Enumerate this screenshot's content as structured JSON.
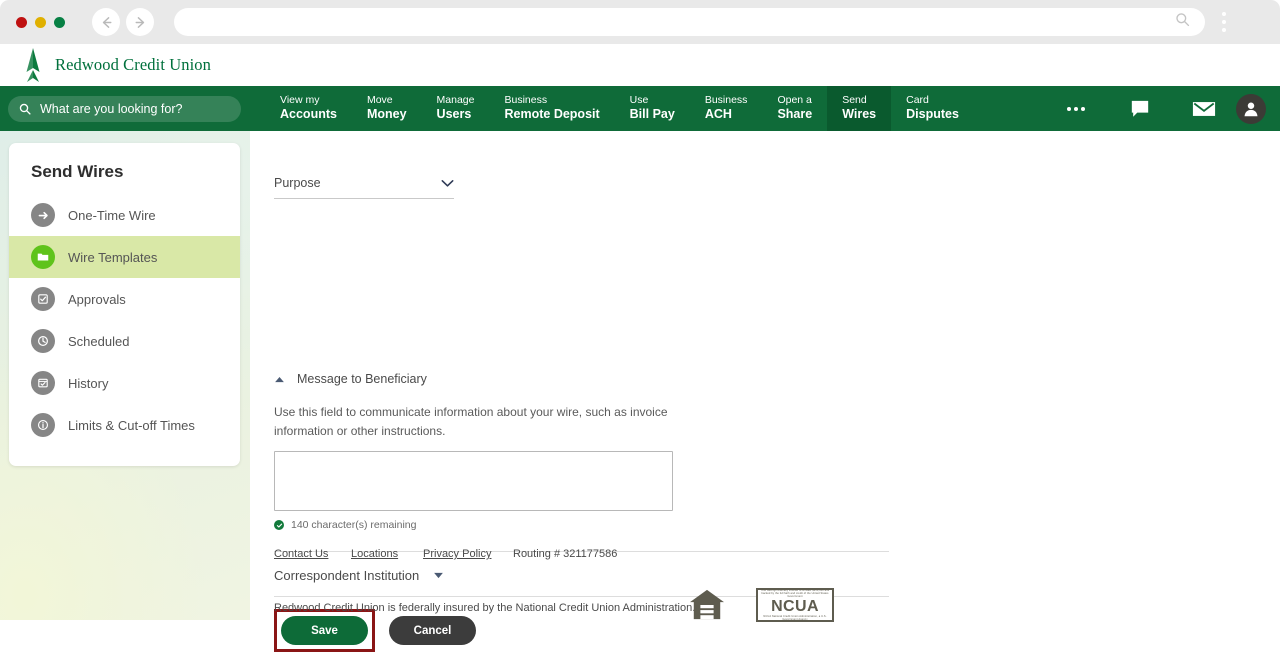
{
  "browser": {
    "url_value": "",
    "url_placeholder": "",
    "back_icon": "back-arrow-icon",
    "forward_icon": "forward-arrow-icon",
    "search_icon": "search-icon",
    "menu_icon": "kebab-menu-icon"
  },
  "brand": {
    "name": "Redwood Credit Union",
    "logo_icon": "redwood-tree-logo",
    "primary_green": "#0f6b39",
    "active_green": "#0a5a2e",
    "accent_lime": "#5fc31b",
    "highlight_red": "#8a1515"
  },
  "navbar": {
    "search_placeholder": "What are you looking for?",
    "search_icon": "search-icon",
    "items": [
      {
        "top": "View my",
        "bottom": "Accounts",
        "active": false
      },
      {
        "top": "Move",
        "bottom": "Money",
        "active": false
      },
      {
        "top": "Manage",
        "bottom": "Users",
        "active": false
      },
      {
        "top": "Business",
        "bottom": "Remote Deposit",
        "active": false
      },
      {
        "top": "Use",
        "bottom": "Bill Pay",
        "active": false
      },
      {
        "top": "Business",
        "bottom": "ACH",
        "active": false
      },
      {
        "top": "Open a",
        "bottom": "Share",
        "active": false
      },
      {
        "top": "Send",
        "bottom": "Wires",
        "active": true
      },
      {
        "top": "Card",
        "bottom": "Disputes",
        "active": false
      }
    ],
    "more_icon": "ellipsis-icon",
    "chat_icon": "chat-bubble-icon",
    "mail_icon": "envelope-icon",
    "profile_icon": "user-avatar-icon"
  },
  "sidebar": {
    "title": "Send Wires",
    "items": [
      {
        "label": "One-Time Wire",
        "icon": "arrow-right-circle-icon",
        "active": false
      },
      {
        "label": "Wire Templates",
        "icon": "folder-icon",
        "active": true
      },
      {
        "label": "Approvals",
        "icon": "check-circle-icon",
        "active": false
      },
      {
        "label": "Scheduled",
        "icon": "clock-icon",
        "active": false
      },
      {
        "label": "History",
        "icon": "calendar-check-icon",
        "active": false
      },
      {
        "label": "Limits & Cut-off Times",
        "icon": "info-circle-icon",
        "active": false
      }
    ]
  },
  "form": {
    "purpose_label": "Purpose",
    "purpose_chevron_icon": "chevron-down-icon",
    "message_section_label": "Message to Beneficiary",
    "message_section_caret_icon": "caret-up-icon",
    "helper_text": "Use this field to communicate information about your wire, such as invoice information or other instructions.",
    "message_value": "",
    "message_placeholder": "",
    "char_count_text": "140 character(s) remaining",
    "char_count_icon": "check-badge-icon",
    "correspondent_label": "Correspondent Institution",
    "correspondent_caret_icon": "caret-down-icon",
    "save_label": "Save",
    "cancel_label": "Cancel"
  },
  "footer": {
    "links": [
      "Contact Us",
      "Locations",
      "Privacy Policy"
    ],
    "routing": "Routing # 321177586",
    "disclosure": "Redwood Credit Union is federally insured by the National Credit Union Administration.",
    "housing_icon": "equal-housing-lender-icon",
    "ncua_word": "NCUA",
    "ncua_top_text": "Your savings federally insured to at least $250,000 and backed by the full faith and credit of the United States Government",
    "ncua_bottom_text": "NCUA  National Credit Union Administration, a U.S. Government Agency"
  }
}
